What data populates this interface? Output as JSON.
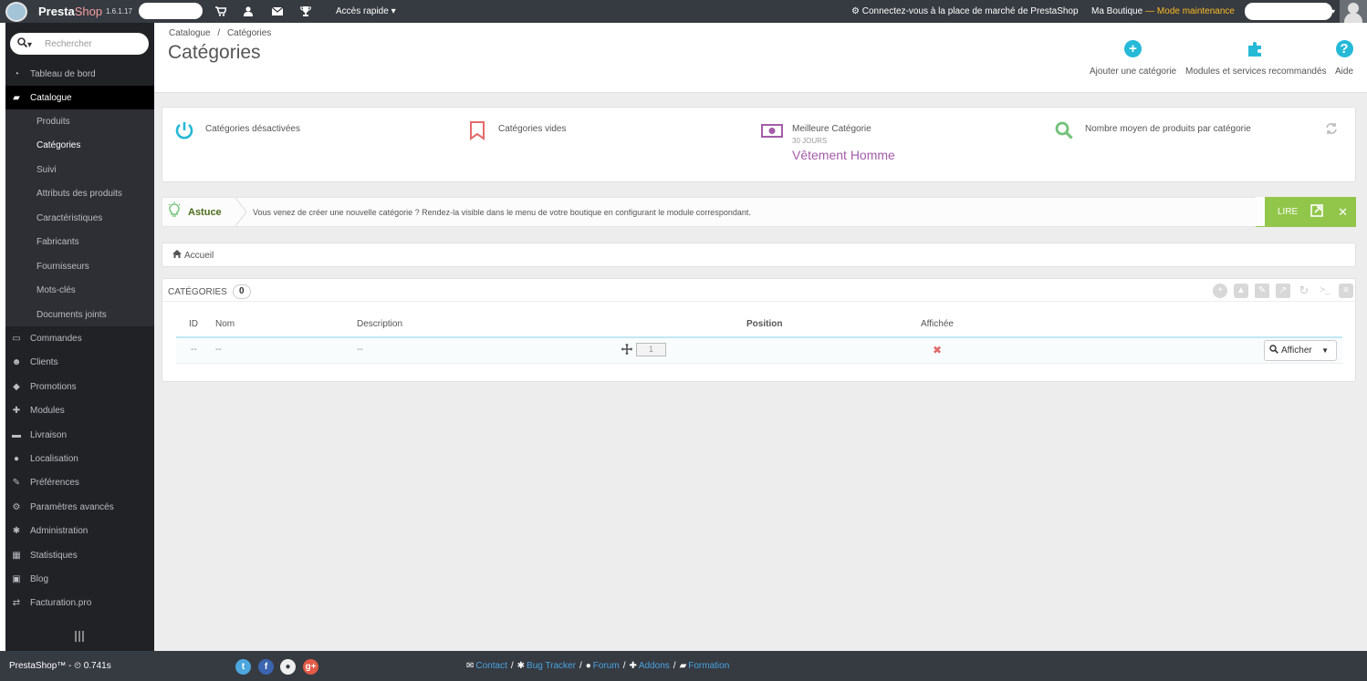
{
  "topbar": {
    "brand_a": "Presta",
    "brand_b": "Shop",
    "version": "1.6.1.17",
    "quick_access": "Accès rapide",
    "marketplace": "Connectez-vous à la place de marché de PrestaShop",
    "shop_name": "Ma Boutique",
    "maintenance": "— Mode maintenance",
    "icons": [
      "cart-icon",
      "user-icon",
      "envelope-icon",
      "trophy-icon"
    ]
  },
  "sidebar": {
    "search_placeholder": "Rechercher",
    "items": [
      {
        "label": "Tableau de bord",
        "icon": "dashboard-icon"
      },
      {
        "label": "Catalogue",
        "icon": "book-icon"
      },
      {
        "label": "Commandes",
        "icon": "credit-card-icon"
      },
      {
        "label": "Clients",
        "icon": "users-icon"
      },
      {
        "label": "Promotions",
        "icon": "tags-icon"
      },
      {
        "label": "Modules",
        "icon": "puzzle-icon"
      },
      {
        "label": "Livraison",
        "icon": "truck-icon"
      },
      {
        "label": "Localisation",
        "icon": "globe-icon"
      },
      {
        "label": "Préférences",
        "icon": "wrench-icon"
      },
      {
        "label": "Paramètres avancés",
        "icon": "cogs-icon"
      },
      {
        "label": "Administration",
        "icon": "cog-icon"
      },
      {
        "label": "Statistiques",
        "icon": "bar-chart-icon"
      },
      {
        "label": "Blog",
        "icon": "edit-icon"
      },
      {
        "label": "Facturation.pro",
        "icon": "exchange-icon"
      }
    ],
    "submenu": [
      "Produits",
      "Catégories",
      "Suivi",
      "Attributs des produits",
      "Caractéristiques",
      "Fabricants",
      "Fournisseurs",
      "Mots-clés",
      "Documents joints"
    ]
  },
  "header": {
    "breadcrumb_parent": "Catalogue",
    "breadcrumb_sep": "/",
    "breadcrumb_current": "Catégories",
    "title": "Catégories",
    "toolbar": {
      "add": "Ajouter une catégorie",
      "modules": "Modules et services recommandés",
      "help": "Aide"
    }
  },
  "kpis": {
    "disabled": "Catégories désactivées",
    "empty": "Catégories vides",
    "best": "Meilleure Catégorie",
    "best_period": "30 JOURS",
    "best_value": "Vêtement Homme",
    "avg": "Nombre moyen de produits par catégorie"
  },
  "tip": {
    "label": "Astuce",
    "message": "Vous venez de créer une nouvelle catégorie ? Rendez-la visible dans le menu de votre boutique en configurant le module correspondant.",
    "read": "LIRE"
  },
  "home_breadcrumb": "Accueil",
  "list": {
    "heading": "CATÉGORIES",
    "count": "0",
    "columns": {
      "id": "ID",
      "name": "Nom",
      "description": "Description",
      "position": "Position",
      "displayed": "Affichée"
    },
    "filter_row": {
      "id": "--",
      "name": "--",
      "description": "--",
      "position": "1"
    },
    "show_button": "Afficher"
  },
  "footer": {
    "version": "PrestaShop™ - ⏲ 0.741s",
    "links": [
      "Contact",
      "Bug Tracker",
      "Forum",
      "Addons",
      "Formation"
    ]
  },
  "colors": {
    "accent": "#25b9d7",
    "tip_green": "#92c64a",
    "kpi_value": "#a45ca8",
    "maintenance": "#fbbb22",
    "sidebar": "#202226"
  }
}
